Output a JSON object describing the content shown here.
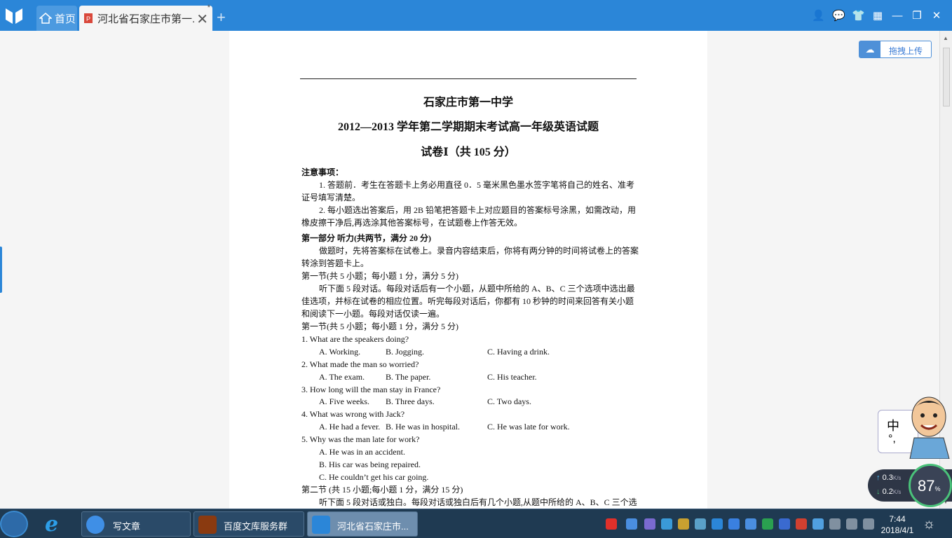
{
  "browser": {
    "home_tab": "首页",
    "doc_tab": "河北省石家庄市第一...",
    "new_tab": "+",
    "upload_button": "拖拽上传"
  },
  "document": {
    "school": "石家庄市第一中学",
    "exam_title": "2012—2013 学年第二学期期末考试高一年级英语试题",
    "paper": "试卷Ⅰ（共  105  分）",
    "notice_heading": "注意事项：",
    "lines": [
      "1. 答题前．考生在答题卡上务必用直径 0．5 毫米黑色墨水签字笔将自己的姓名、准考",
      "证号填写清楚。",
      "2. 每小题选出答案后，用 2B 铅笔把答题卡上对应题目的答案标号涂黑，如需改动，用",
      "橡皮擦干净后,再选涂其他答案标号，在试题卷上作答无效。",
      "第一部分    听力(共两节，满分 20 分)",
      "做题时，先将答案标在试卷上。录音内容结束后，你将有两分钟的时间将试卷上的答案",
      "转涂到答题卡上。",
      "第一节(共 5 小题；每小题 1 分，满分 5 分)",
      "听下面 5 段对话。每段对话后有一个小题，从题中所给的 A、B、C 三个选项中选出最",
      "佳选项，并标在试卷的相应位置。听完每段对话后，你都有 10 秒钟的时间来回答有关小题",
      "和阅读下一小题。每段对话仅读一遍。",
      "第一节(共 5 小题；每小题 1 分，满分 5 分)",
      "1. What are the speakers doing?",
      "2. What made the man so worried?",
      "3. How long will the man stay in France?",
      "4. What was wrong with Jack?",
      "5. Why was the man late for work?",
      "A. He was in an accident.",
      "B. His car was being repaired.",
      "C. He couldn’t get his car going.",
      "第二节  (共 15 小题;每小题 1 分，满分 15 分)",
      "听下面 5 段对话或独白。每段对话或独白后有几个小题,从题中所给的 A、B、C 三个选"
    ],
    "options": [
      [
        "A. Working.",
        "B. Jogging.",
        "C. Having a drink."
      ],
      [
        "A. The exam.",
        "B. The paper.",
        "C. His teacher."
      ],
      [
        "A. Five weeks.",
        "B. Three days.",
        "C. Two days."
      ],
      [
        "A. He had a fever.",
        "B. He was in hospital.",
        "C. He was late for work."
      ]
    ]
  },
  "ime": {
    "lang": "中",
    "punct": "°,"
  },
  "net": {
    "up": "0.3",
    "down": "0.2",
    "unit": "K/s",
    "percent": "87",
    "pct_sign": "%"
  },
  "taskbar": {
    "tasks": [
      "写文章",
      "百度文库服务群",
      "河北省石家庄市..."
    ],
    "time": "7:44",
    "date": "2018/4/1"
  },
  "colors": {
    "titlebar": "#2b86d8",
    "taskbar": "#1f3a52"
  }
}
